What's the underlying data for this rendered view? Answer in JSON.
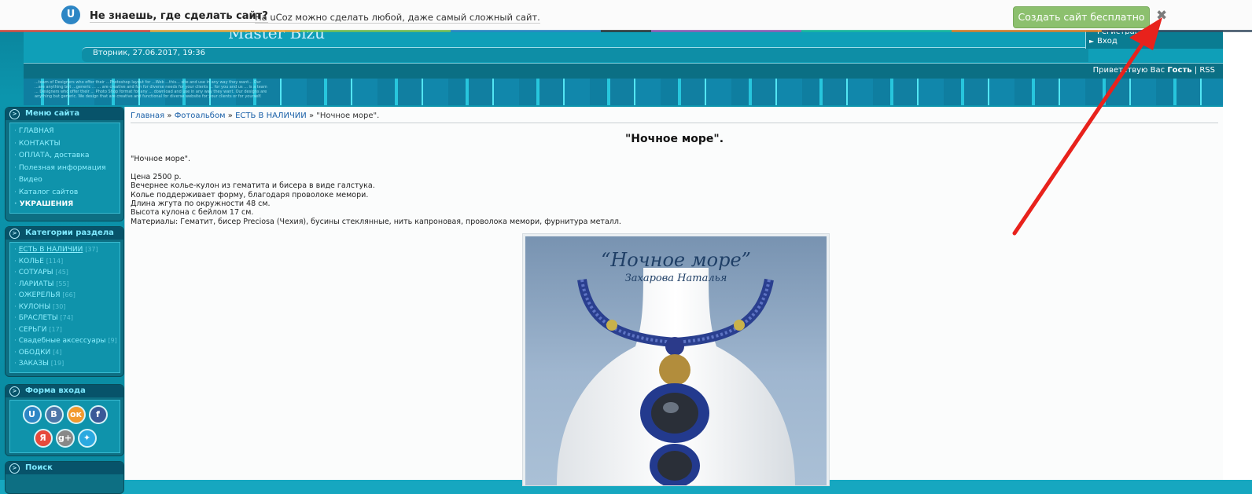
{
  "topbar": {
    "logo_letter": "U",
    "question": "Не знаешь, где сделать сайт?",
    "subtitle": "На uCoz можно сделать любой, даже самый сложный сайт.",
    "cta": "Создать сайт бесплатно",
    "close": "✖"
  },
  "header": {
    "site_title": "Master Bizu",
    "date": "Вторник, 27.06.2017, 19:36",
    "user_links": [
      "Регистрация",
      "Вход"
    ],
    "greeting_prefix": "Приветствую Вас",
    "greeting_name": "Гость",
    "rss": "RSS",
    "separator": " | ",
    "stripe_text": "...team of Designers who offer their ...Photoshop layout for ...Web ...this... site and use in any way they want... Our ...are anything but ...generic ... ... are creative and fun for diverse needs for your clients ... for you and us ... is a team ... Designers who offer their ... Photo Shop format for any ... download and use in any way they want. Our designs are anything but generic. We design that are creative and functional for diverse website for your clients or for yourself."
  },
  "sidebar": {
    "menu": {
      "title": "Меню сайта",
      "items": [
        {
          "label": "ГЛАВНАЯ"
        },
        {
          "label": "КОНТАКТЫ"
        },
        {
          "label": "ОПЛАТА, доставка"
        },
        {
          "label": "Полезная информация"
        },
        {
          "label": "Видео"
        },
        {
          "label": "Каталог сайтов"
        },
        {
          "label": "УКРАШЕНИЯ"
        }
      ]
    },
    "categories": {
      "title": "Категории раздела",
      "items": [
        {
          "label": "ЕСТЬ В НАЛИЧИИ",
          "count": "[37]"
        },
        {
          "label": "КОЛЬЕ",
          "count": "[114]"
        },
        {
          "label": "СОТУАРЫ",
          "count": "[45]"
        },
        {
          "label": "ЛАРИАТЫ",
          "count": "[55]"
        },
        {
          "label": "ОЖЕРЕЛЬЯ",
          "count": "[66]"
        },
        {
          "label": "КУЛОНЫ",
          "count": "[30]"
        },
        {
          "label": "БРАСЛЕТЫ",
          "count": "[74]"
        },
        {
          "label": "СЕРЬГИ",
          "count": "[17]"
        },
        {
          "label": "Свадебные аксессуары",
          "count": "[9]"
        },
        {
          "label": "ОБОДКИ",
          "count": "[4]"
        },
        {
          "label": "ЗАКАЗЫ",
          "count": "[19]"
        }
      ]
    },
    "login": {
      "title": "Форма входа",
      "social": [
        {
          "icon": "ucoz-icon",
          "glyph": "U",
          "color": "#2d86c5"
        },
        {
          "icon": "vk-icon",
          "glyph": "В",
          "color": "#4d77a8"
        },
        {
          "icon": "odnoklassniki-icon",
          "glyph": "ок",
          "color": "#f29a2e"
        },
        {
          "icon": "facebook-icon",
          "glyph": "f",
          "color": "#3b5998"
        },
        {
          "icon": "yandex-icon",
          "glyph": "Я",
          "color": "#e64a3c"
        },
        {
          "icon": "google-plus-icon",
          "glyph": "g+",
          "color": "#888888"
        },
        {
          "icon": "twitter-icon",
          "glyph": "✦",
          "color": "#2aa9e0"
        }
      ]
    },
    "search": {
      "title": "Поиск"
    }
  },
  "content": {
    "breadcrumb": [
      {
        "label": "Главная"
      },
      {
        "label": "Фотоальбом"
      },
      {
        "label": "ЕСТЬ В НАЛИЧИИ"
      }
    ],
    "breadcrumb_sep": " » ",
    "breadcrumb_current": "\"Ночное море\".",
    "title": "\"Ночное море\".",
    "description": "\"Ночное море\".\n\nЦена 2500 р.\nВечернее колье-кулон из гематита и бисера в виде галстука.\nКолье поддерживает форму, благодаря проволоке мемори.\nДлина жгута по окружности 48 см.\nВысота кулона с бейлом 17 см.\nМатериалы: Гематит, бисер Preciosa (Чехия), бусины стеклянные, нить капроновая, проволока мемори, фурнитура металл.",
    "photo": {
      "caption_title": "“Ночное море”",
      "caption_author": "Захарова Наталья"
    }
  },
  "colors": {
    "accent": "#8cc06e",
    "teal": "#0f93ab",
    "arrow": "#e8221c"
  }
}
